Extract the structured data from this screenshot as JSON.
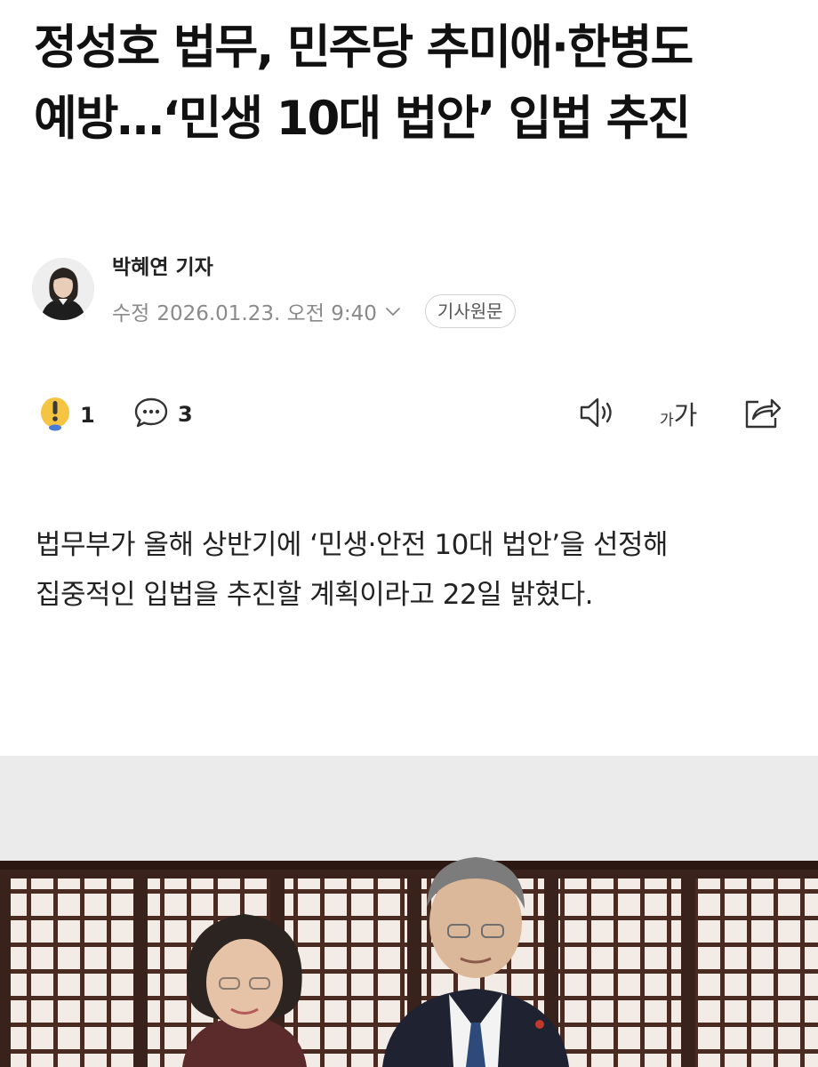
{
  "article": {
    "headline": "정성호 법무, 민주당 추미애·한병도 예방…‘민생 10대 법안’ 입법 추진",
    "reporter": "박혜연 기자",
    "date_prefix": "수정",
    "date": "2026.01.23. 오전 9:40",
    "original_link_label": "기사원문",
    "body": "법무부가 올해 상반기에 ‘민생·안전 10대 법안’을 선정해 집중적인 입법을 추진할 계획이라고 22일 밝혔다."
  },
  "actions": {
    "reaction_count": "1",
    "comment_count": "3",
    "font_size_small": "가",
    "font_size_large": "가"
  },
  "icons": {
    "reaction": "surprise-emoji-icon",
    "comment": "speech-bubble-icon",
    "audio": "speaker-icon",
    "share": "share-icon",
    "date_toggle": "chevron-down-icon"
  },
  "colors": {
    "text_primary": "#111111",
    "text_muted": "#8a8a8a",
    "emoji_yellow": "#f6c443",
    "icon_gray": "#333333"
  }
}
